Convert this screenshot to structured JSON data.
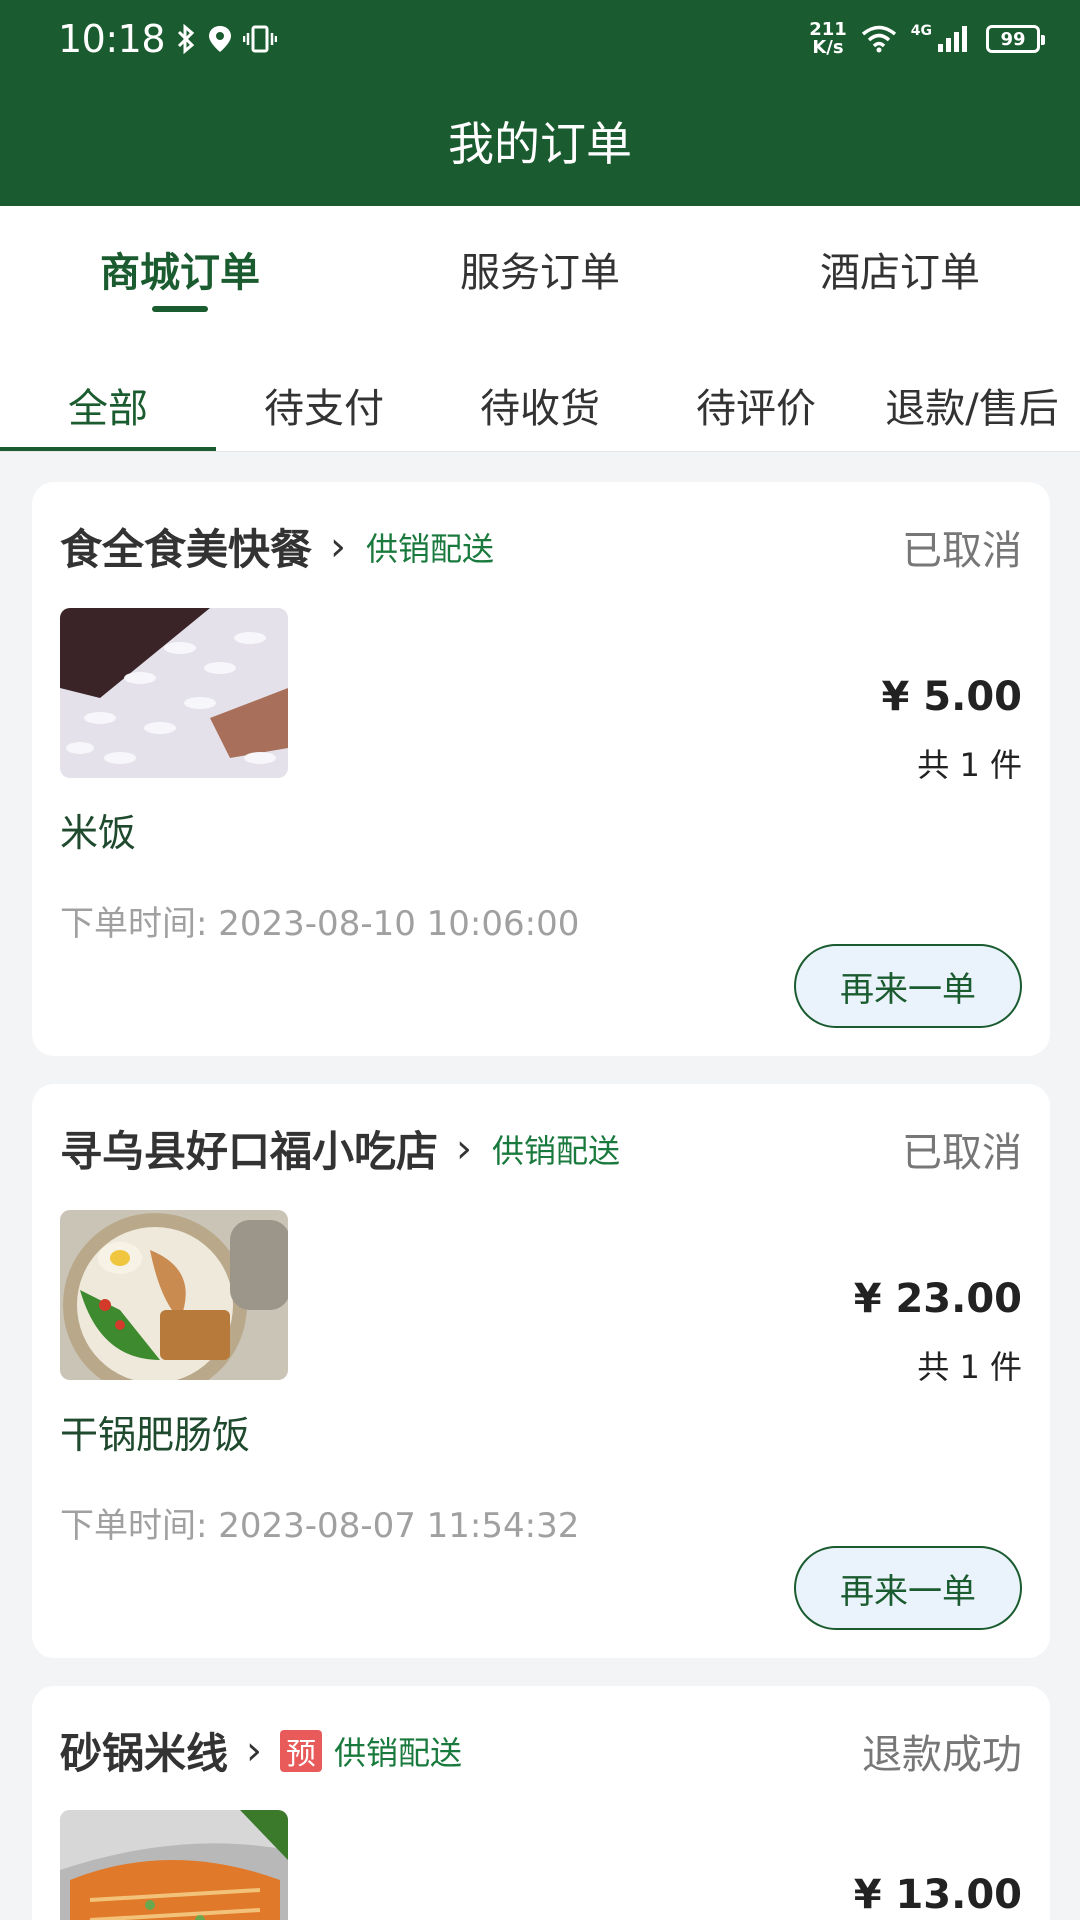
{
  "status_bar": {
    "time": "10:18",
    "net_speed_top": "211",
    "net_speed_bottom": "K/s",
    "signal": "4G",
    "battery": "99"
  },
  "header": {
    "title": "我的订单"
  },
  "main_tabs": [
    {
      "label": "商城订单",
      "active": true
    },
    {
      "label": "服务订单",
      "active": false
    },
    {
      "label": "酒店订单",
      "active": false
    }
  ],
  "sub_tabs": [
    {
      "label": "全部",
      "active": true
    },
    {
      "label": "待支付",
      "active": false
    },
    {
      "label": "待收货",
      "active": false
    },
    {
      "label": "待评价",
      "active": false
    },
    {
      "label": "退款/售后",
      "active": false
    }
  ],
  "colors": {
    "brand_green": "#1a5b2f",
    "delivery_green": "#1a7a3e",
    "pre_tag_red": "#e95a5a"
  },
  "orders": [
    {
      "store": "食全食美快餐",
      "delivery": "供销配送",
      "status": "已取消",
      "price": "¥ 5.00",
      "qty": "共 1 件",
      "item": "米饭",
      "time": "下单时间: 2023-08-10 10:06:00",
      "reorder": "再来一单"
    },
    {
      "store": "寻乌县好口福小吃店",
      "delivery": "供销配送",
      "status": "已取消",
      "price": "¥ 23.00",
      "qty": "共 1 件",
      "item": "干锅肥肠饭",
      "time": "下单时间: 2023-08-07 11:54:32",
      "reorder": "再来一单"
    },
    {
      "store": "砂锅米线",
      "pre_tag": "预",
      "delivery": "供销配送",
      "status": "退款成功",
      "price": "¥ 13.00"
    }
  ]
}
